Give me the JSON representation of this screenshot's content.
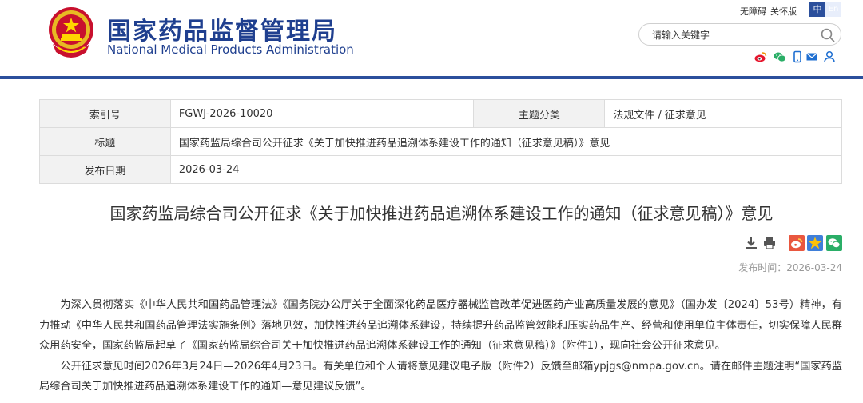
{
  "site": {
    "name_cn": "国家药品监督管理局",
    "name_en": "National Medical Products Administration",
    "toplinks": [
      "无障碍",
      "关怀版"
    ],
    "lang": {
      "zh": "中",
      "en": "En"
    },
    "search": {
      "placeholder": "请输入关键字"
    },
    "social_icons": [
      "weibo-icon",
      "wechat-icon",
      "mobile-icon",
      "mail-icon",
      "user-icon"
    ],
    "colors": {
      "brand": "#1f3f8f",
      "divider": "#2b4f9c",
      "lang_active": "#2b4f9c"
    }
  },
  "meta": {
    "index_label": "索引号",
    "index_value": "FGWJ-2026-10020",
    "topic_label": "主题分类",
    "topic_value": "法规文件 / 征求意见",
    "title_label": "标题",
    "title_value": "国家药监局综合司公开征求《关于加快推进药品追溯体系建设工作的通知（征求意见稿）》意见",
    "date_label": "发布日期",
    "date_value": "2026-03-24"
  },
  "article": {
    "title": "国家药监局综合司公开征求《关于加快推进药品追溯体系建设工作的通知（征求意见稿）》意见",
    "publish_time": "发布时间：2026-03-24",
    "tools": [
      "download-icon",
      "print-icon",
      "share-weibo-icon",
      "share-qzone-icon",
      "share-wechat-icon"
    ],
    "paragraphs": [
      "为深入贯彻落实《中华人民共和国药品管理法》《国务院办公厅关于全面深化药品医疗器械监管改革促进医药产业高质量发展的意见》（国办发〔2024〕53号）精神，有力推动《中华人民共和国药品管理法实施条例》落地见效，加快推进药品追溯体系建设，持续提升药品监管效能和压实药品生产、经营和使用单位主体责任，切实保障人民群众用药安全，国家药监局起草了《国家药监局综合司关于加快推进药品追溯体系建设工作的通知（征求意见稿）》（附件1），现向社会公开征求意见。",
      "公开征求意见时间2026年3月24日—2026年4月23日。有关单位和个人请将意见建议电子版（附件2）反馈至邮箱ypjgs@nmpa.gov.cn。请在邮件主题注明“国家药监局综合司关于加快推进药品追溯体系建设工作的通知—意见建议反馈”。"
    ]
  }
}
